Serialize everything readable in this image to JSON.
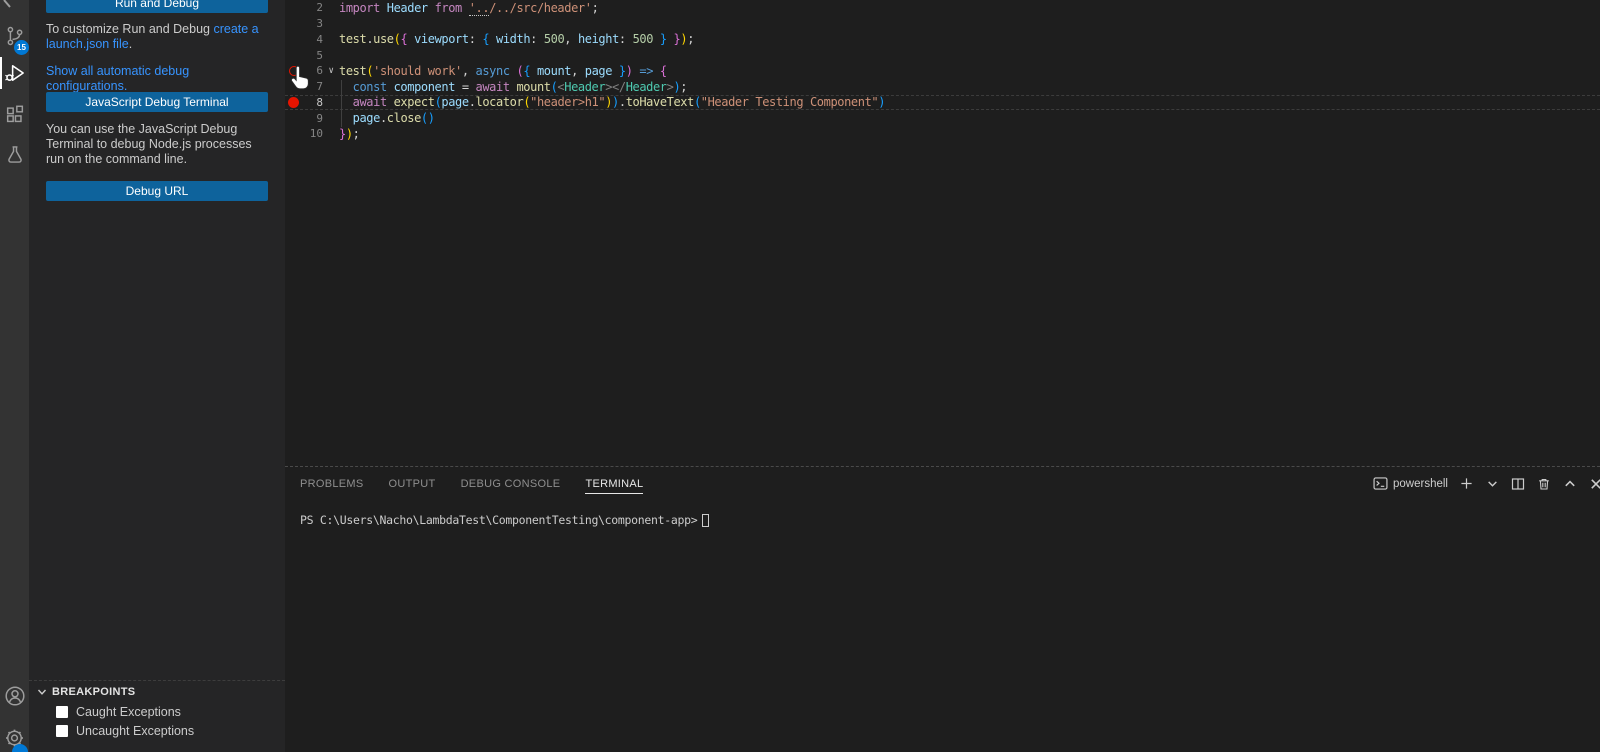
{
  "colors": {
    "button_bg": "#0E639C",
    "link": "#3794FF",
    "badge_bg": "#0078D4",
    "breakpoint_red": "#E51400"
  },
  "activity_bar": {
    "source_control_badge": "15",
    "icons": [
      "search-icon-partial",
      "source-control-icon",
      "run-and-debug-icon",
      "extensions-icon",
      "testing-icon",
      "accounts-icon",
      "settings-gear-icon"
    ]
  },
  "sidebar": {
    "run_button": "Run and Debug",
    "customize_pre": "To customize Run and Debug ",
    "customize_link": "create a launch.json file",
    "customize_post": ".",
    "show_configs_link": "Show all automatic debug configurations.",
    "js_terminal_button": "JavaScript Debug Terminal",
    "js_terminal_desc": "You can use the JavaScript Debug Terminal to debug Node.js processes run on the command line.",
    "debug_url_button": "Debug URL",
    "breakpoints_header": "BREAKPOINTS",
    "breakpoints": [
      {
        "label": "Caught Exceptions",
        "checked": false
      },
      {
        "label": "Uncaught Exceptions",
        "checked": false
      }
    ]
  },
  "editor": {
    "token_colors": {
      "kw": "#C586C0",
      "kw2": "#569CD6",
      "fn": "#DCDCAA",
      "var": "#9CDCFE",
      "str": "#CE9178",
      "num": "#B5CEA8",
      "type": "#4EC9B0",
      "tag": "#808080",
      "fg": "#D4D4D4",
      "b1": "#FFD700",
      "b2": "#DA70D6",
      "b3": "#179FFF"
    },
    "lines": [
      {
        "num": "2",
        "tokens": [
          [
            "kw",
            "import "
          ],
          [
            "var",
            "Header"
          ],
          [
            "fg",
            " "
          ],
          [
            "kw",
            "from"
          ],
          [
            "fg",
            " "
          ],
          [
            "str-u",
            "'.."
          ],
          [
            "str",
            "/../src/header'"
          ],
          [
            "fg",
            ";"
          ]
        ]
      },
      {
        "num": "3",
        "tokens": []
      },
      {
        "num": "4",
        "tokens": [
          [
            "fn",
            "test"
          ],
          [
            "fg",
            "."
          ],
          [
            "fn",
            "use"
          ],
          [
            "b1",
            "("
          ],
          [
            "b2",
            "{"
          ],
          [
            "fg",
            " "
          ],
          [
            "var",
            "viewport"
          ],
          [
            "fg",
            ": "
          ],
          [
            "b3",
            "{"
          ],
          [
            "fg",
            " "
          ],
          [
            "var",
            "width"
          ],
          [
            "fg",
            ": "
          ],
          [
            "num",
            "500"
          ],
          [
            "fg",
            ", "
          ],
          [
            "var",
            "height"
          ],
          [
            "fg",
            ": "
          ],
          [
            "num",
            "500"
          ],
          [
            "fg",
            " "
          ],
          [
            "b3",
            "}"
          ],
          [
            "fg",
            " "
          ],
          [
            "b2",
            "}"
          ],
          [
            "b1",
            ")"
          ],
          [
            "fg",
            ";"
          ]
        ]
      },
      {
        "num": "5",
        "tokens": []
      },
      {
        "num": "6",
        "fold": true,
        "breakpoint": "ring",
        "tokens": [
          [
            "fn",
            "test"
          ],
          [
            "b1",
            "("
          ],
          [
            "str",
            "'should work'"
          ],
          [
            "fg",
            ", "
          ],
          [
            "kw2",
            "async"
          ],
          [
            "fg",
            " "
          ],
          [
            "b2",
            "("
          ],
          [
            "b3",
            "{"
          ],
          [
            "fg",
            " "
          ],
          [
            "var",
            "mount"
          ],
          [
            "fg",
            ", "
          ],
          [
            "var",
            "page"
          ],
          [
            "fg",
            " "
          ],
          [
            "b3",
            "}"
          ],
          [
            "b2",
            ")"
          ],
          [
            "fg",
            " "
          ],
          [
            "kw2",
            "=>"
          ],
          [
            "fg",
            " "
          ],
          [
            "b2",
            "{"
          ]
        ]
      },
      {
        "num": "7",
        "tokens": [
          [
            "fg",
            "  "
          ],
          [
            "kw2",
            "const"
          ],
          [
            "fg",
            " "
          ],
          [
            "var",
            "component"
          ],
          [
            "fg",
            " = "
          ],
          [
            "kw",
            "await"
          ],
          [
            "fg",
            " "
          ],
          [
            "fn",
            "mount"
          ],
          [
            "b3",
            "("
          ],
          [
            "tag",
            "<"
          ],
          [
            "type",
            "Header"
          ],
          [
            "tag",
            "></"
          ],
          [
            "type",
            "Header"
          ],
          [
            "tag",
            ">"
          ],
          [
            "b3",
            ")"
          ],
          [
            "fg",
            ";"
          ]
        ]
      },
      {
        "num": "8",
        "breakpoint": "dot",
        "current": true,
        "tokens": [
          [
            "fg",
            "  "
          ],
          [
            "kw",
            "await"
          ],
          [
            "fg",
            " "
          ],
          [
            "fn",
            "expect"
          ],
          [
            "b3",
            "("
          ],
          [
            "var",
            "page"
          ],
          [
            "fg",
            "."
          ],
          [
            "fn",
            "locator"
          ],
          [
            "b1",
            "("
          ],
          [
            "str",
            "\"header>h1\""
          ],
          [
            "b1",
            ")"
          ],
          [
            "b3",
            ")"
          ],
          [
            "fg",
            "."
          ],
          [
            "fn",
            "toHaveText"
          ],
          [
            "b3",
            "("
          ],
          [
            "str",
            "\"Header Testing Component\""
          ],
          [
            "b3",
            ")"
          ]
        ]
      },
      {
        "num": "9",
        "tokens": [
          [
            "fg",
            "  "
          ],
          [
            "var",
            "page"
          ],
          [
            "fg",
            "."
          ],
          [
            "fn",
            "close"
          ],
          [
            "b3",
            "("
          ],
          [
            "b3",
            ")"
          ]
        ]
      },
      {
        "num": "10",
        "tokens": [
          [
            "b2",
            "}"
          ],
          [
            "b1",
            ")"
          ],
          [
            "fg",
            ";"
          ]
        ]
      }
    ]
  },
  "panel": {
    "tabs": [
      {
        "label": "PROBLEMS",
        "active": false
      },
      {
        "label": "OUTPUT",
        "active": false
      },
      {
        "label": "DEBUG CONSOLE",
        "active": false
      },
      {
        "label": "TERMINAL",
        "active": true
      }
    ],
    "shell_label": "powershell",
    "terminal_prompt": "PS C:\\Users\\Nacho\\LambdaTest\\ComponentTesting\\component-app>"
  }
}
